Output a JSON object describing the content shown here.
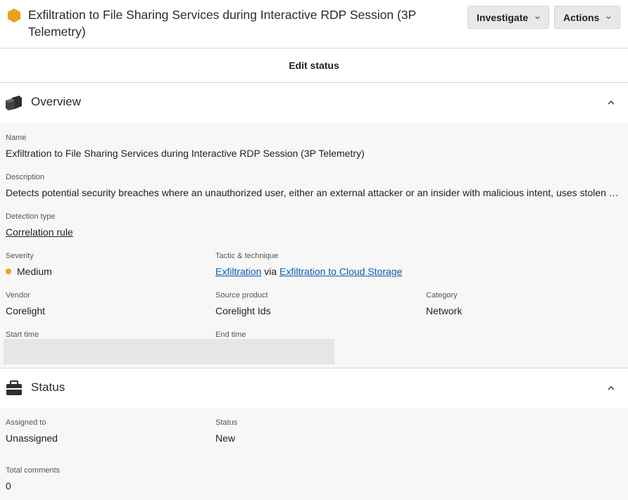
{
  "header": {
    "title": "Exfiltration to File Sharing Services during Interactive RDP Session (3P Telemetry)",
    "investigate_label": "Investigate",
    "actions_label": "Actions"
  },
  "edit_status": {
    "label": "Edit status"
  },
  "overview": {
    "title": "Overview",
    "name_label": "Name",
    "name_value": "Exfiltration to File Sharing Services during Interactive RDP Session (3P Telemetry)",
    "description_label": "Description",
    "description_value": "Detects potential security breaches where an unauthorized user, either an external attacker or an insider with malicious intent, uses stolen o…",
    "detection_type_label": "Detection type",
    "detection_type_value": "Correlation rule",
    "severity_label": "Severity",
    "severity_value": "Medium",
    "tactic_label": "Tactic & technique",
    "tactic_value": "Exfiltration",
    "tactic_via": "via",
    "technique_value": "Exfiltration to Cloud Storage",
    "vendor_label": "Vendor",
    "vendor_value": "Corelight",
    "source_product_label": "Source product",
    "source_product_value": "Corelight Ids",
    "category_label": "Category",
    "category_value": "Network",
    "start_time_label": "Start time",
    "end_time_label": "End time"
  },
  "status": {
    "title": "Status",
    "assigned_label": "Assigned to",
    "assigned_value": "Unassigned",
    "status_label": "Status",
    "status_value": "New",
    "comments_label": "Total comments",
    "comments_value": "0"
  },
  "colors": {
    "severity_medium": "#e8a317",
    "link": "#0b5cad"
  }
}
